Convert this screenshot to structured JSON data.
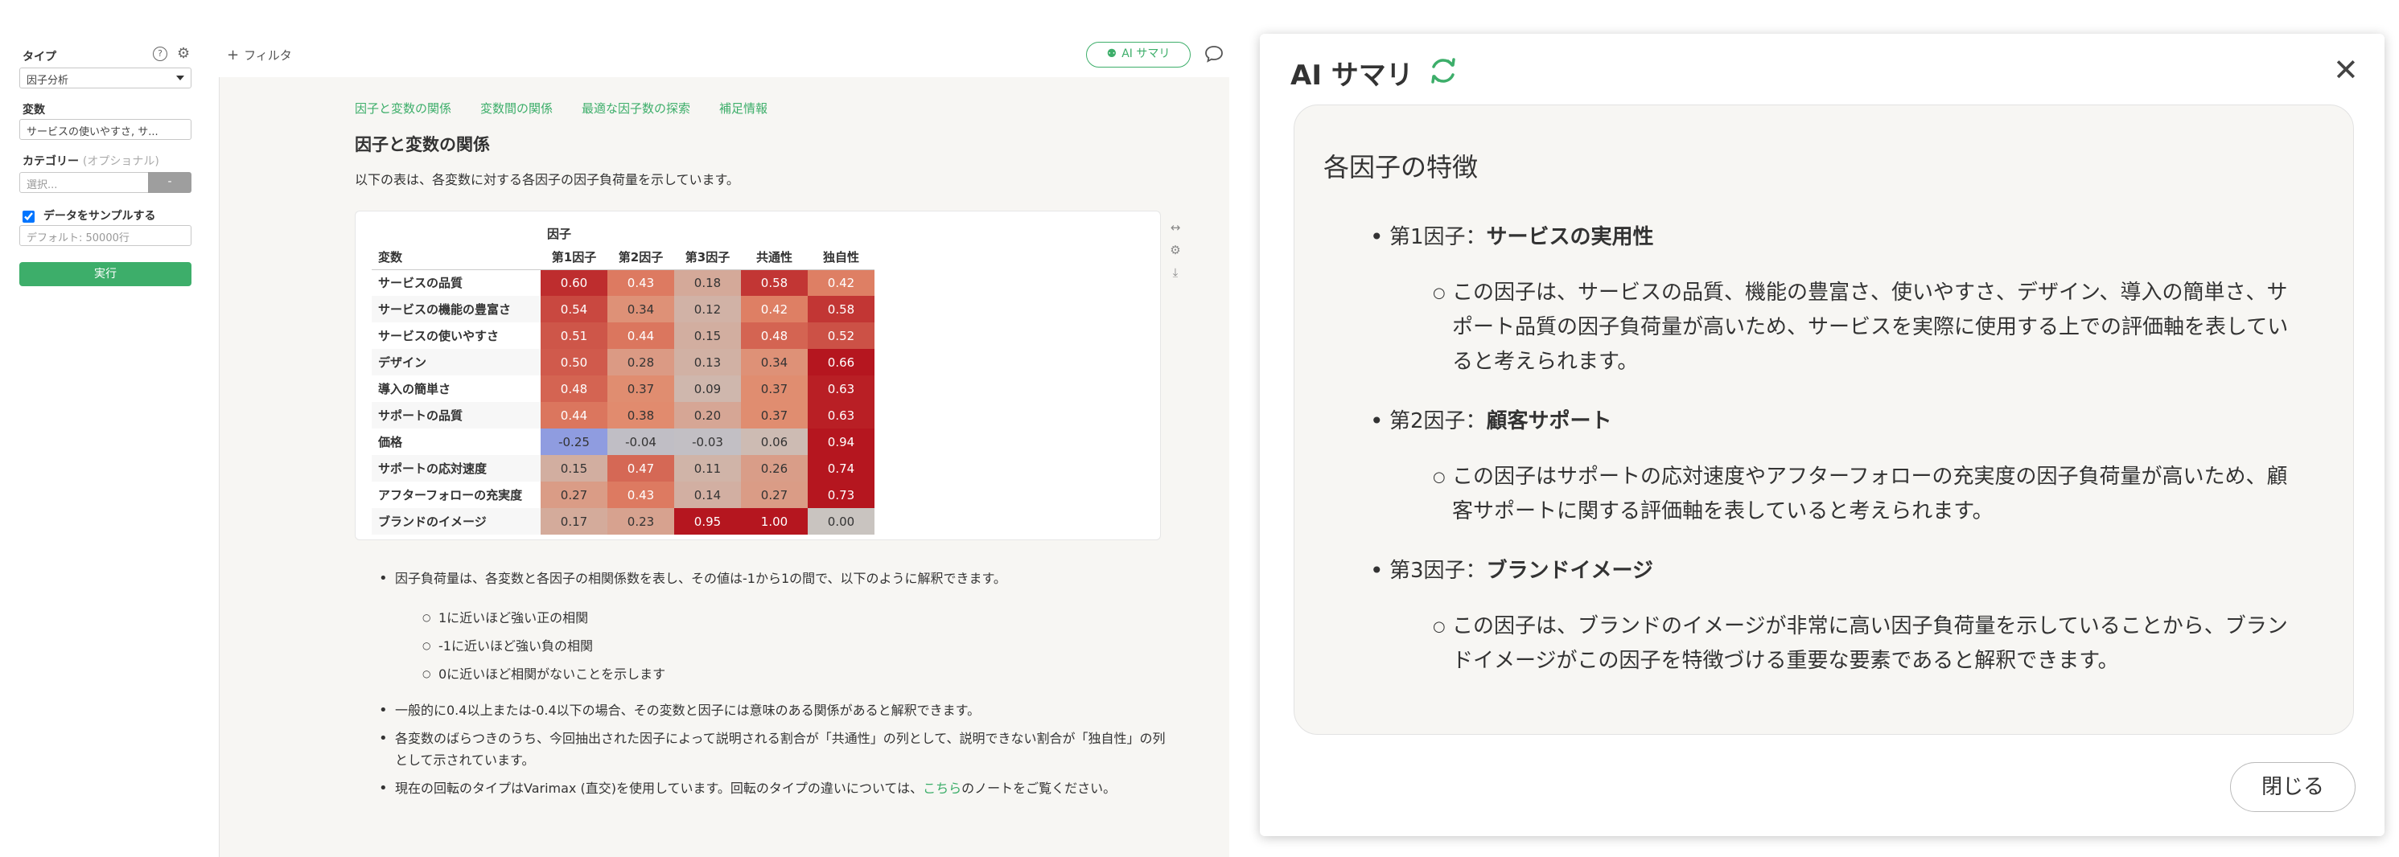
{
  "sidebar": {
    "type_label": "タイプ",
    "type_value": "因子分析",
    "vars_label": "変数",
    "vars_value": "サービスの使いやすさ, サ...",
    "category_label": "カテゴリー",
    "category_optional": "(オプショナル)",
    "category_placeholder": "選択...",
    "category_button": "-",
    "sample_label": "データをサンプルする",
    "sample_placeholder": "デフォルト: 50000行",
    "run_label": "実行"
  },
  "topbar": {
    "filter_label": "フィルタ",
    "ai_label": "AI サマリ"
  },
  "main": {
    "tabs": [
      "因子と変数の関係",
      "変数間の関係",
      "最適な因子数の探索",
      "補足情報"
    ],
    "title": "因子と変数の関係",
    "description": "以下の表は、各変数に対する各因子の因子負荷量を示しています。",
    "table": {
      "group_header": "因子",
      "var_header": "変数",
      "columns": [
        "第1因子",
        "第2因子",
        "第3因子",
        "共通性",
        "独自性"
      ],
      "rows": [
        {
          "name": "サービスの品質",
          "values": [
            "0.60",
            "0.43",
            "0.18",
            "0.58",
            "0.42"
          ]
        },
        {
          "name": "サービスの機能の豊富さ",
          "values": [
            "0.54",
            "0.34",
            "0.12",
            "0.42",
            "0.58"
          ]
        },
        {
          "name": "サービスの使いやすさ",
          "values": [
            "0.51",
            "0.44",
            "0.15",
            "0.48",
            "0.52"
          ]
        },
        {
          "name": "デザイン",
          "values": [
            "0.50",
            "0.28",
            "0.13",
            "0.34",
            "0.66"
          ]
        },
        {
          "name": "導入の簡単さ",
          "values": [
            "0.48",
            "0.37",
            "0.09",
            "0.37",
            "0.63"
          ]
        },
        {
          "name": "サポートの品質",
          "values": [
            "0.44",
            "0.38",
            "0.20",
            "0.37",
            "0.63"
          ]
        },
        {
          "name": "価格",
          "values": [
            "-0.25",
            "-0.04",
            "-0.03",
            "0.06",
            "0.94"
          ]
        },
        {
          "name": "サポートの応対速度",
          "values": [
            "0.15",
            "0.47",
            "0.11",
            "0.26",
            "0.74"
          ]
        },
        {
          "name": "アフターフォローの充実度",
          "values": [
            "0.27",
            "0.43",
            "0.14",
            "0.27",
            "0.73"
          ]
        },
        {
          "name": "ブランドのイメージ",
          "values": [
            "0.17",
            "0.23",
            "0.95",
            "1.00",
            "0.00"
          ]
        }
      ]
    },
    "notes": {
      "n1": "因子負荷量は、各変数と各因子の相関係数を表し、その値は-1から1の間で、以下のように解釈できます。",
      "n1_sub": [
        "1に近いほど強い正の相関",
        "-1に近いほど強い負の相関",
        "0に近いほど相関がないことを示します"
      ],
      "n2": "一般的に0.4以上または-0.4以下の場合、その変数と因子には意味のある関係があると解釈できます。",
      "n3": "各変数のばらつきのうち、今回抽出された因子によって説明される割合が「共通性」の列として、説明できない割合が「独自性」の列として示されています。",
      "n4_pre": "現在の回転のタイプはVarimax (直交)を使用しています。回転のタイプの違いについては、",
      "n4_link": "こちら",
      "n4_post": "のノートをご覧ください。"
    }
  },
  "dialog": {
    "title": "AI サマリ",
    "heading": "各因子の特徴",
    "factors": [
      {
        "label": "第1因子：",
        "name": "サービスの実用性",
        "desc": "この因子は、サービスの品質、機能の豊富さ、使いやすさ、デザイン、導入の簡単さ、サポート品質の因子負荷量が高いため、サービスを実際に使用する上での評価軸を表していると考えられます。"
      },
      {
        "label": "第2因子：",
        "name": "顧客サポート",
        "desc": "この因子はサポートの応対速度やアフターフォローの充実度の因子負荷量が高いため、顧客サポートに関する評価軸を表していると考えられます。"
      },
      {
        "label": "第3因子：",
        "name": "ブランドイメージ",
        "desc": "この因子は、ブランドのイメージが非常に高い因子負荷量を示していることから、ブランドイメージがこの因子を特徴づける重要な要素であると解釈できます。"
      }
    ],
    "close_label": "閉じる"
  },
  "colors": {
    "accent_green": "#3dae6a",
    "heat_high": "#b5161f",
    "heat_mid": "#e2886a",
    "heat_neutral": "#c9c4c0",
    "heat_negative": "#8f9ce0"
  },
  "icons": {
    "help": "question-circle-icon",
    "settings": "gear-icon",
    "expand": "horizontal-arrows-icon",
    "download": "download-icon",
    "comment": "speech-bubble-icon",
    "refresh": "refresh-icon",
    "close": "close-icon",
    "ai": "robot-icon"
  }
}
